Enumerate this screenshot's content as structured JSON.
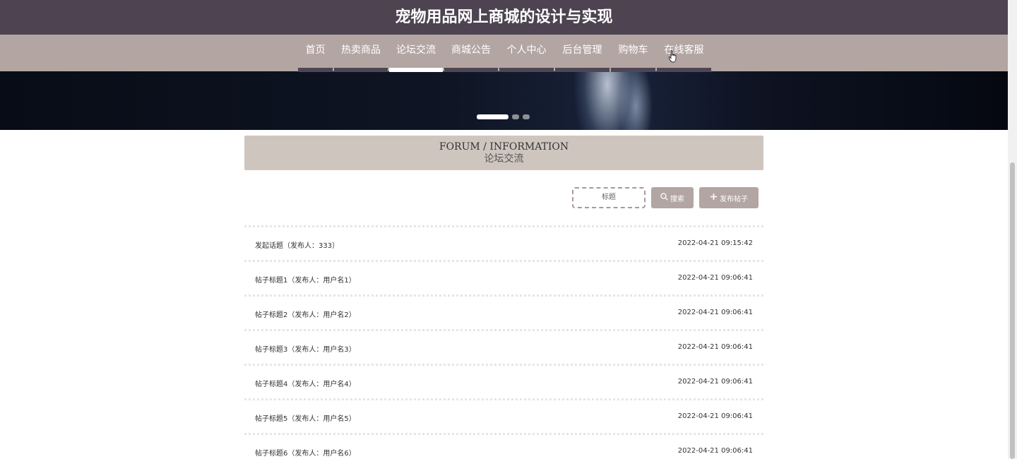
{
  "header": {
    "site_title": "宠物用品网上商城的设计与实现"
  },
  "nav": {
    "items": [
      {
        "label": "首页",
        "active": false
      },
      {
        "label": "热卖商品",
        "active": false
      },
      {
        "label": "论坛交流",
        "active": true
      },
      {
        "label": "商城公告",
        "active": false
      },
      {
        "label": "个人中心",
        "active": false
      },
      {
        "label": "后台管理",
        "active": false
      },
      {
        "label": "购物车",
        "active": false
      },
      {
        "label": "在线客服",
        "active": false
      }
    ]
  },
  "banner": {
    "slide_count": 3,
    "active_slide": 1
  },
  "section": {
    "title_en": "FORUM / INFORMATION",
    "title_cn": "论坛交流"
  },
  "search": {
    "placeholder": "标题",
    "value": "",
    "search_label": "搜索",
    "post_label": "发布帖子"
  },
  "posts": [
    {
      "title": "发起话题（发布人：333）",
      "time": "2022-04-21 09:15:42"
    },
    {
      "title": "帖子标题1（发布人：用户名1）",
      "time": "2022-04-21 09:06:41"
    },
    {
      "title": "帖子标题2（发布人：用户名2）",
      "time": "2022-04-21 09:06:41"
    },
    {
      "title": "帖子标题3（发布人：用户名3）",
      "time": "2022-04-21 09:06:41"
    },
    {
      "title": "帖子标题4（发布人：用户名4）",
      "time": "2022-04-21 09:06:41"
    },
    {
      "title": "帖子标题5（发布人：用户名5）",
      "time": "2022-04-21 09:06:41"
    },
    {
      "title": "帖子标题6（发布人：用户名6）",
      "time": "2022-04-21 09:06:41"
    }
  ],
  "colors": {
    "title_bar": "#4d4351",
    "nav_bar": "#b3a6a2",
    "section_head": "#cfc5bf",
    "button": "#b3a6a2"
  },
  "icons": {
    "search_button": "search-icon",
    "post_button": "plus-icon"
  }
}
